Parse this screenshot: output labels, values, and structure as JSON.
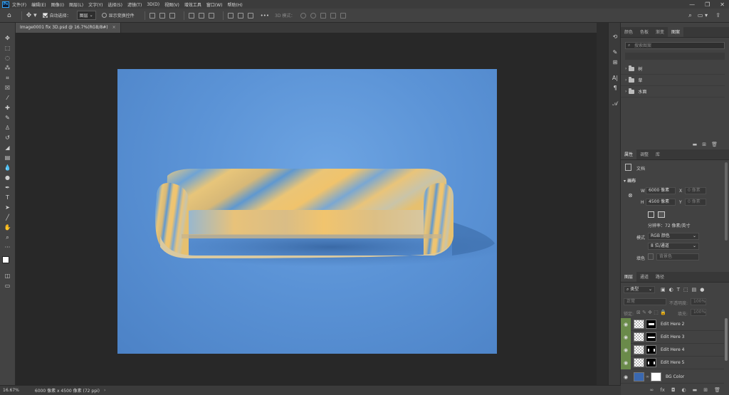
{
  "app": {
    "logo": "Ps"
  },
  "menu": [
    "文件(F)",
    "编辑(E)",
    "图像(I)",
    "图层(L)",
    "文字(Y)",
    "选择(S)",
    "滤镜(T)",
    "3D(D)",
    "视图(V)",
    "增效工具",
    "窗口(W)",
    "帮助(H)"
  ],
  "options": {
    "auto_select_label": "自动选择：",
    "auto_select_value": "图层",
    "show_transform_label": "显示变换控件",
    "mode_3d_label": "3D 模式：",
    "more_label": "•••"
  },
  "document": {
    "tab_title": "Image0001 fix 3D.psd @ 16.7%(RGB/8#)",
    "close": "×"
  },
  "status": {
    "zoom": "16.67%",
    "info": "6000 像素 x 4500 像素 (72 ppi)",
    "arrow": "›"
  },
  "top_panel": {
    "tabs": [
      "颜色",
      "色板",
      "渐变",
      "图案"
    ],
    "active_tab": 3,
    "search_placeholder": "搜索图案",
    "groups": [
      "树",
      "草",
      "水面"
    ]
  },
  "properties": {
    "tabs": [
      "属性",
      "调整",
      "库"
    ],
    "active_tab": 0,
    "doc_label": "文档",
    "canvas_label": "画布",
    "w_label": "W",
    "w_value": "6000 像素",
    "h_label": "H",
    "h_value": "4500 像素",
    "x_label": "X",
    "x_value": "0 像素",
    "y_label": "Y",
    "y_value": "0 像素",
    "resolution": "分辨率：72 像素/英寸",
    "mode_label": "模式",
    "mode_value": "RGB 颜色",
    "depth_value": "8 位/通道",
    "fill_label": "填色",
    "fill_value": "背景色"
  },
  "layers": {
    "tabs": [
      "图层",
      "通道",
      "路径"
    ],
    "active_tab": 0,
    "filter_label": "类型",
    "blend_mode": "正常",
    "opacity_label": "不透明度:",
    "opacity_value": "100%",
    "lock_label": "锁定:",
    "fill_label": "填充:",
    "fill_value": "100%",
    "items": [
      {
        "name": "Edit Here 2",
        "kind": "smart"
      },
      {
        "name": "Edit Here 3",
        "kind": "smart"
      },
      {
        "name": "Edit Here 4",
        "kind": "smart"
      },
      {
        "name": "Edit Here 5",
        "kind": "smart"
      },
      {
        "name": "BG Color",
        "kind": "color"
      }
    ]
  },
  "colors": {
    "accent": "#31a8ff",
    "canvas_bg": "#5b93d6",
    "layer_eye_highlight": "#6a8a4a",
    "bg_color_swatch": "#3a68b0"
  }
}
